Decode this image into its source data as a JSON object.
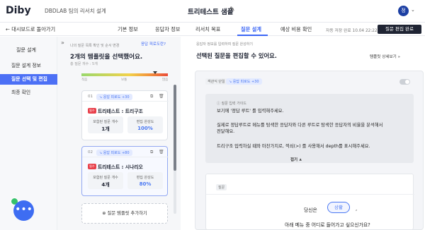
{
  "header": {
    "logo": "Diby",
    "project": "DBDLAB 팀의 리서치 설계",
    "title": "트리테스트 샘플",
    "edit_icon": "✎",
    "avatar": "정",
    "chevron": "⌄"
  },
  "subbar": {
    "back": "←  대시보드로 돌아가기",
    "tabs": [
      "기본 정보",
      "응답자 정보",
      "리서치 목표",
      "질문 설계",
      "예상 비용 확인"
    ],
    "saved": "자동 저장 완료 10.04 22:22",
    "done": "질문 편집 완료"
  },
  "sidebar": {
    "heading": "질문 설계",
    "items": [
      "질문 설계 정보",
      "질문 선택 및 편집",
      "최종 확인"
    ]
  },
  "middle": {
    "collapse": "»",
    "label": "나의 질문 목록 확인 및 순서 변경",
    "link": "응답 피로도란?",
    "title": "2개의 템플릿을 선택했어요.",
    "count": "총 질문 개수 : 5개",
    "fatigue": 0.85,
    "bar_labels": [
      "적음",
      "보통",
      "많음"
    ],
    "cards": [
      {
        "num": "01",
        "tag": "↘ 응답 피로도 +30",
        "icon1": "⧉",
        "icon2": "🗑",
        "badge": "필수",
        "title": "트리테스트 : 트리구조",
        "box1_label": "포함된 질문 개수",
        "box1_value": "1개",
        "box2_label": "편집 완성도",
        "box2_value": "100%"
      },
      {
        "num": "02",
        "tag": "↘ 응답 피로도 +80",
        "icon1": "⧉",
        "icon2": "🗑",
        "badge": "필수",
        "title": "트리테스트 : 시나리오",
        "box1_label": "포함된 질문 개수",
        "box1_value": "4개",
        "box2_label": "편집 완성도",
        "box2_value": "80%"
      }
    ],
    "add": "⊕  질문 템플릿 추가하기"
  },
  "right": {
    "label": "응답자 정보를 입력하여 질문 완성하기",
    "title": "선택된 질문을 편집할 수 있어요.",
    "link": "템플릿 상세보기  »",
    "panel": {
      "label": "객관식 단일",
      "tag": "↘ 응답 피로도 +30",
      "guide_label": "ⓘ 질문 입력 가이드",
      "guide_lines": [
        "보기에 '정답 루트' 를 입력해주세요.",
        "실제로 정답루트로 메뉴를 탐색한 응답자와 다른 루트로 탐색한 응답자의 비율을 분석해서",
        "전달해요.",
        "트리구조 입력하실 때와 마찬가지로, 꺽쇠(>) 를 사용해서 depth를 표시해주세요."
      ],
      "fold": "접기  ∧",
      "q_label": "질문",
      "q_pre": "당신은",
      "q_chip": "상황",
      "q_post": ",",
      "q_line2": "아래 메뉴 중 어디로 들어가고 싶으신가요?"
    }
  },
  "colors": {
    "accent": "#3b66f5",
    "dark": "#1f2433"
  }
}
